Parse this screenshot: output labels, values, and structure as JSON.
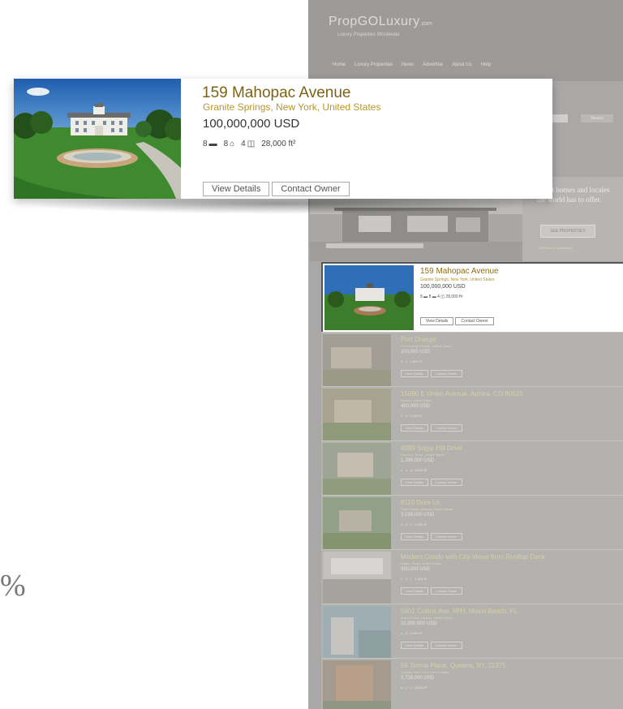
{
  "site": {
    "logo": "PropGOLuxury",
    "logo_suffix": ".com",
    "tagline": "Luxury Properties Worldwide",
    "nav": [
      "Home",
      "Luxury Properties",
      "News",
      "Advertise",
      "About Us",
      "Help"
    ],
    "search_button": "Search",
    "hero_copy": "...best homes and locales the world has to offer.",
    "hero_button": "SEE PROPERTIES",
    "hero_link": "All Property Categories"
  },
  "featured": {
    "title": "159 Mahopac Avenue",
    "location": "Granite Springs, New York, United States",
    "price": "100,000,000 USD",
    "beds": "8",
    "baths": "8",
    "rooms": "4",
    "area": "28,000 ft²",
    "view_details": "View Details",
    "contact_owner": "Contact Owner"
  },
  "listings": [
    {
      "title": "Port Orange",
      "location": "Port Orange, Florida, United States",
      "price": "320,000 USD",
      "meta": "3 · 2 · 1,500 ft²"
    },
    {
      "title": "15090 E Union Avenue, Aurora, CO 80015",
      "location": "Aurora, United States",
      "price": "450,000 USD",
      "meta": "3 · 3 · 2,200 ft²"
    },
    {
      "title": "4089 Sugar Hill Drive",
      "location": "Houston, Texas, United States",
      "price": "1,399,000 USD",
      "meta": "4 · 4 · 3 · 3,600 ft²"
    },
    {
      "title": "8110 Dore Ln",
      "location": "Falls Church, Virginia, United States",
      "price": "3,199,000 USD",
      "meta": "5 · 5 · 2 · 6,800 ft²"
    },
    {
      "title": "Modern Condo with City Views from Rooftop Deck",
      "location": "Dallas, Texas, United States",
      "price": "650,000 USD",
      "meta": "2 · 2 · 1 · 1,300 ft²"
    },
    {
      "title": "5601 Collins Ave. #PH, Miami Beach, FL",
      "location": "Miami Beach, Florida, United States",
      "price": "21,000,000 USD",
      "meta": "4 · 5 · 4,000 ft²"
    },
    {
      "title": "56 Tennis Place, Queens, NY, 11375",
      "location": "Queens, New York, United States",
      "price": "3,738,000 USD",
      "meta": "6 · 4 · 1 · 3,500 ft²"
    }
  ],
  "listing_buttons": {
    "view": "View Details",
    "contact": "Contact Owner"
  },
  "margin_text": "%"
}
